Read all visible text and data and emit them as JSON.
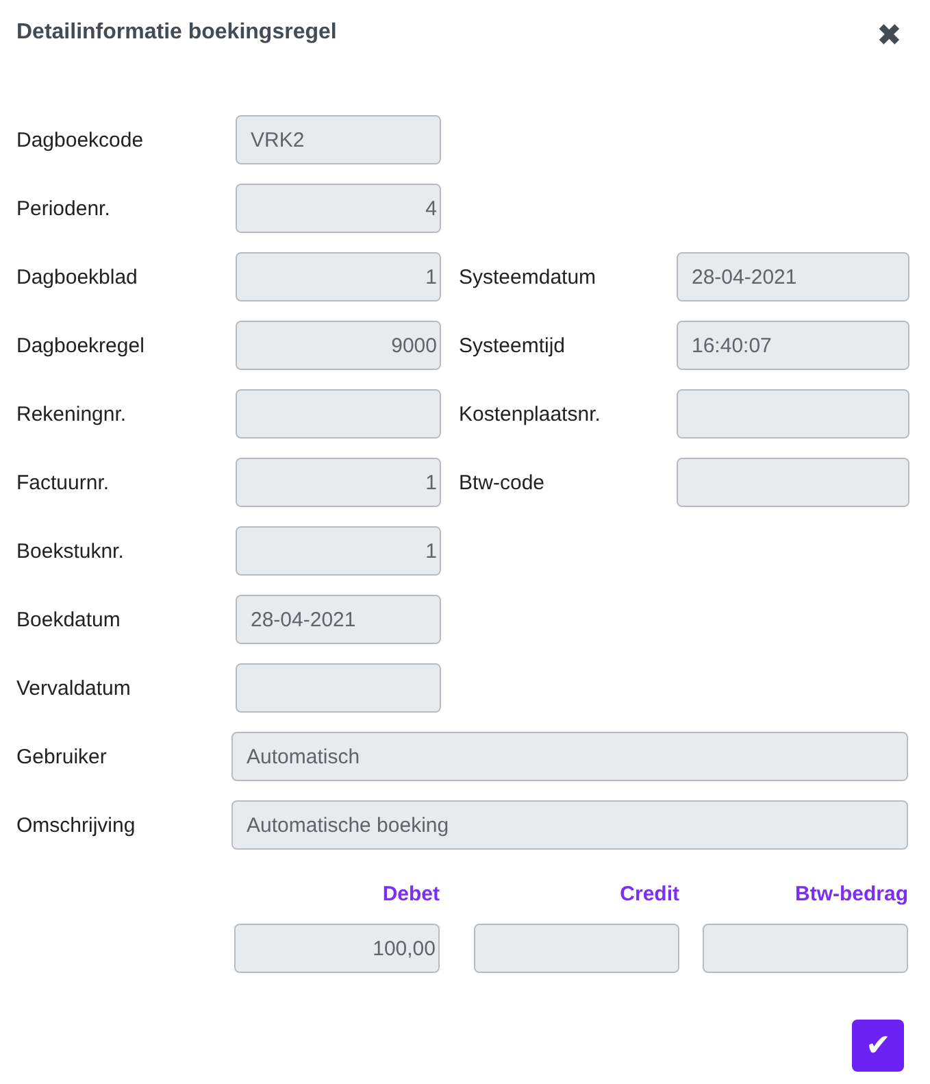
{
  "dialog": {
    "title": "Detailinformatie boekingsregel",
    "close": "✖"
  },
  "rows": [
    {
      "left": {
        "label": "Dagboekcode",
        "value": "VRK2",
        "numeric": false
      }
    },
    {
      "left": {
        "label": "Periodenr.",
        "value": "4",
        "numeric": true
      }
    },
    {
      "left": {
        "label": "Dagboekblad",
        "value": "1",
        "numeric": true
      },
      "right": {
        "label": "Systeemdatum",
        "value": "28-04-2021",
        "numeric": false
      }
    },
    {
      "left": {
        "label": "Dagboekregel",
        "value": "9000",
        "numeric": true
      },
      "right": {
        "label": "Systeemtijd",
        "value": "16:40:07",
        "numeric": false
      }
    },
    {
      "left": {
        "label": "Rekeningnr."
      },
      "right": {
        "label": "Kostenplaatsnr."
      }
    },
    {
      "left": {
        "label": "Factuurnr.",
        "value": "1",
        "numeric": true
      },
      "right": {
        "label": "Btw-code"
      }
    },
    {
      "left": {
        "label": "Boekstuknr.",
        "value": "1",
        "numeric": true
      }
    },
    {
      "left": {
        "label": "Boekdatum",
        "value": "28-04-2021",
        "numeric": false
      }
    },
    {
      "left": {
        "label": "Vervaldatum"
      }
    }
  ],
  "wide_rows": [
    {
      "label": "Gebruiker",
      "value": "Automatisch"
    },
    {
      "label": "Omschrijving",
      "value": "Automatische boeking"
    }
  ],
  "amounts": [
    {
      "label": "Debet",
      "value": "100,00"
    },
    {
      "label": "Credit"
    },
    {
      "label": "Btw-bedrag"
    }
  ],
  "confirm": {
    "icon": "✔"
  }
}
